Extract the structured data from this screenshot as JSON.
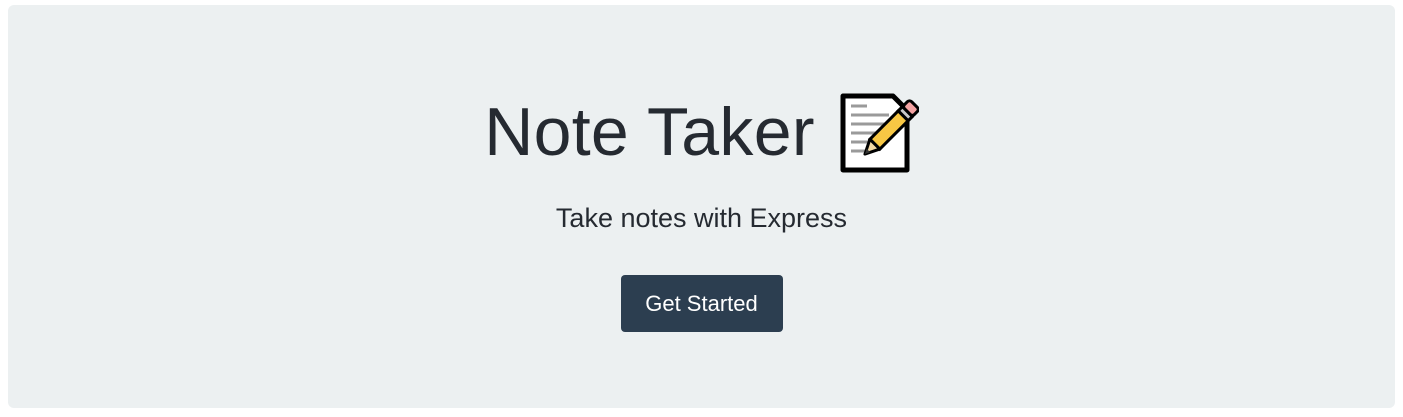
{
  "hero": {
    "title": "Note Taker",
    "title_icon": "memo-icon",
    "subtitle": "Take notes with Express",
    "cta_label": "Get Started"
  },
  "colors": {
    "background": "#ecf0f1",
    "text": "#252a31",
    "button": "#2c3e50",
    "button_text": "#ffffff"
  }
}
